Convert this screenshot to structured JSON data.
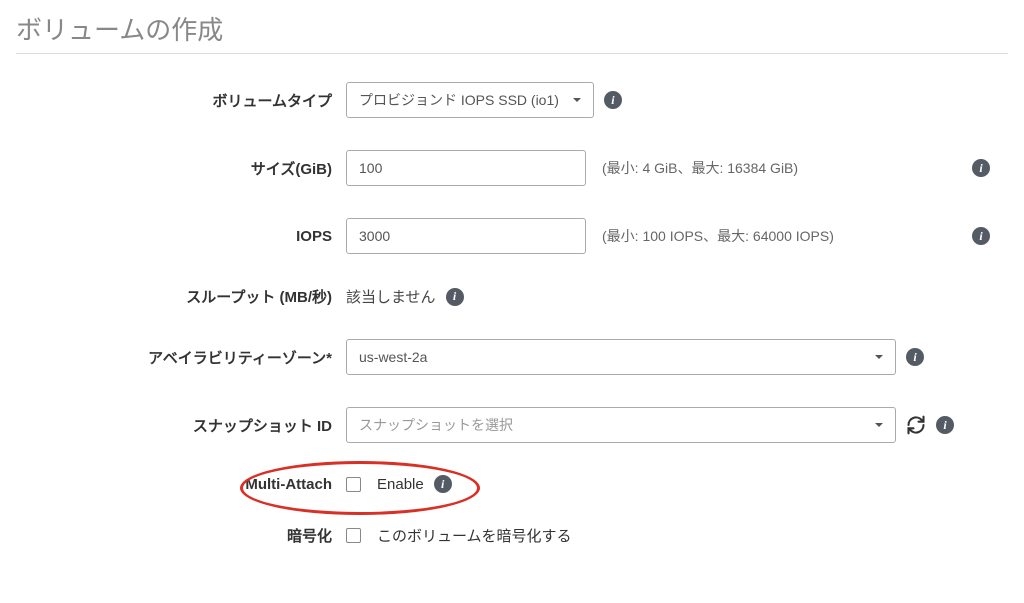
{
  "title": "ボリュームの作成",
  "fields": {
    "volume_type": {
      "label": "ボリュームタイプ",
      "value": "プロビジョンド IOPS SSD (io1)"
    },
    "size": {
      "label": "サイズ(GiB)",
      "value": "100",
      "hint": "(最小: 4 GiB、最大: 16384 GiB)"
    },
    "iops": {
      "label": "IOPS",
      "value": "3000",
      "hint": "(最小: 100 IOPS、最大: 64000 IOPS)"
    },
    "throughput": {
      "label": "スループット (MB/秒)",
      "value": "該当しません"
    },
    "az": {
      "label": "アベイラビリティーゾーン*",
      "value": "us-west-2a"
    },
    "snapshot": {
      "label": "スナップショット ID",
      "placeholder": "スナップショットを選択"
    },
    "multi_attach": {
      "label": "Multi-Attach",
      "enable": "Enable"
    },
    "encryption": {
      "label": "暗号化",
      "text": "このボリュームを暗号化する"
    }
  },
  "icons": {
    "info": "i"
  }
}
